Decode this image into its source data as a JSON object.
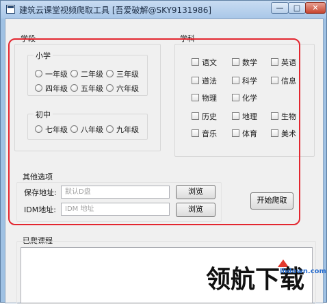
{
  "window": {
    "title": "建筑云课堂视频爬取工具 [吾爱破解@SKY9131986]",
    "controls": {
      "minimize": "—",
      "maximize": "□",
      "close": "✕"
    }
  },
  "stage_group": {
    "label": "学段",
    "primary": {
      "label": "小学",
      "grades": [
        "一年级",
        "二年级",
        "三年级",
        "四年级",
        "五年级",
        "六年级"
      ]
    },
    "middle": {
      "label": "初中",
      "grades": [
        "七年级",
        "八年级",
        "九年级"
      ]
    }
  },
  "subject_group": {
    "label": "学科",
    "subjects": [
      "语文",
      "数学",
      "英语",
      "道法",
      "科学",
      "信息",
      "物理",
      "化学",
      "历史",
      "地理",
      "生物",
      "音乐",
      "体育",
      "美术"
    ]
  },
  "options_group": {
    "label": "其他选项",
    "save_path": {
      "label": "保存地址:",
      "placeholder": "默认D盘",
      "browse": "浏览"
    },
    "idm_path": {
      "label": "IDM地址:",
      "placeholder": "IDM 地址",
      "browse": "浏览"
    },
    "start_button": "开始爬取"
  },
  "crawled_group": {
    "label": "已爬课程"
  },
  "watermark": {
    "text": "领航下载",
    "url": "lhdown.com"
  },
  "colors": {
    "highlight": "#e3262f",
    "title_bar": "#a9c7e8"
  }
}
